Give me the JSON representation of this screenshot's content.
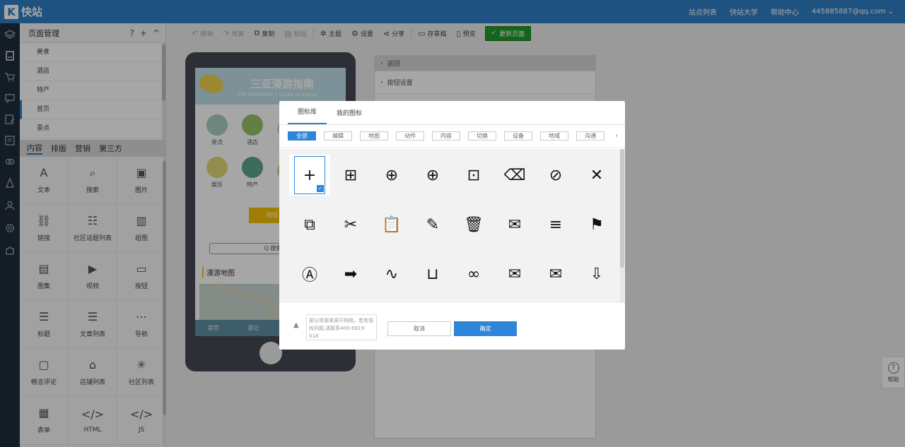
{
  "app": {
    "logo_mark": "K",
    "title": "快站"
  },
  "topnav": {
    "items": [
      "站点列表",
      "快站大学",
      "帮助中心",
      "445885887@qq.com ⌄"
    ]
  },
  "rail": {
    "icons": [
      "layers-icon",
      "page-icon",
      "cart-icon",
      "chat-icon",
      "edit-icon",
      "list-icon",
      "link-icon",
      "stack-icon",
      "user-icon",
      "settings-icon",
      "puzzle-icon"
    ]
  },
  "left": {
    "title": "页面管理",
    "tools": {
      "help": "?",
      "add": "+",
      "collapse": "^"
    },
    "pages": [
      "美食",
      "酒店",
      "特产",
      "首页",
      "景点"
    ],
    "tabs": [
      "内容",
      "排版",
      "营销",
      "第三方"
    ],
    "widgets": [
      {
        "label": "文本",
        "glyph": "A"
      },
      {
        "label": "搜索",
        "glyph": "⌕"
      },
      {
        "label": "图片",
        "glyph": "▣"
      },
      {
        "label": "链接",
        "glyph": "⛓"
      },
      {
        "label": "社区话题列表",
        "glyph": "☷"
      },
      {
        "label": "组图",
        "glyph": "▥"
      },
      {
        "label": "图集",
        "glyph": "▤"
      },
      {
        "label": "视频",
        "glyph": "▶"
      },
      {
        "label": "按钮",
        "glyph": "▭"
      },
      {
        "label": "标题",
        "glyph": "☰"
      },
      {
        "label": "文章列表",
        "glyph": "☰"
      },
      {
        "label": "导航",
        "glyph": "⋯"
      },
      {
        "label": "畅言评论",
        "glyph": "▢"
      },
      {
        "label": "店铺列表",
        "glyph": "⌂"
      },
      {
        "label": "社区列表",
        "glyph": "✳"
      },
      {
        "label": "表单",
        "glyph": "▦"
      },
      {
        "label": "HTML",
        "glyph": "</>"
      },
      {
        "label": "JS",
        "glyph": "</>"
      }
    ]
  },
  "toolbar": {
    "undo": "撤销",
    "redo": "恢复",
    "copy": "复制",
    "paste": "粘贴",
    "theme": "主题",
    "settings": "设置",
    "share": "分享",
    "draft": "存草稿",
    "preview": "预览",
    "publish": "更新页面"
  },
  "phone": {
    "banner_title": "三亚漫游指南",
    "banner_sub": "The Hitchhiker's Guide to Sanya",
    "icons": [
      "景点",
      "酒店",
      "",
      "",
      "娱乐",
      "特产",
      "",
      ""
    ],
    "button": "按钮",
    "search": "Q 搜索",
    "map_title": "漫游地图",
    "nav": [
      "首页",
      "游记"
    ]
  },
  "props": {
    "back": "返回",
    "button_settings": "按钮设置"
  },
  "help": {
    "label": "帮助",
    "glyph": "?"
  },
  "modal": {
    "tabs": [
      "图标库",
      "我的图标"
    ],
    "categories": [
      "全部",
      "编辑",
      "地图",
      "动作",
      "内容",
      "切换",
      "设备",
      "地域",
      "沟通"
    ],
    "more": "›",
    "icons": [
      [
        "+",
        "⊞",
        "⊕",
        "⊕",
        "⊡",
        "⌫",
        "⊘",
        "✕"
      ],
      [
        "⧉",
        "✂",
        "📋",
        "✎",
        "🗑",
        "✉",
        "≡",
        "⚑"
      ],
      [
        "Ⓐ",
        "➡",
        "∿",
        "⊔",
        "∞",
        "✉",
        "✉",
        "⇩"
      ]
    ],
    "icon_names": [
      [
        "add-icon",
        "add-box-icon",
        "add-circle-icon",
        "add-circle-outline-icon",
        "archive-icon",
        "backspace-icon",
        "block-icon",
        "clear-icon"
      ],
      [
        "copy-icon",
        "cut-icon",
        "paste-icon",
        "create-icon",
        "delete-sweep-icon",
        "drafts-icon",
        "filter-list-icon",
        "flag-icon"
      ],
      [
        "font-download-icon",
        "forward-icon",
        "gesture-icon",
        "inbox-icon",
        "link-icon",
        "mail-icon",
        "markunread-icon",
        "move-to-inbox-icon"
      ]
    ],
    "note": "部分资源来源于网络，若有侵权问题,请联系400-6819-018",
    "warn": "▲",
    "cancel": "取消",
    "ok": "确定"
  }
}
